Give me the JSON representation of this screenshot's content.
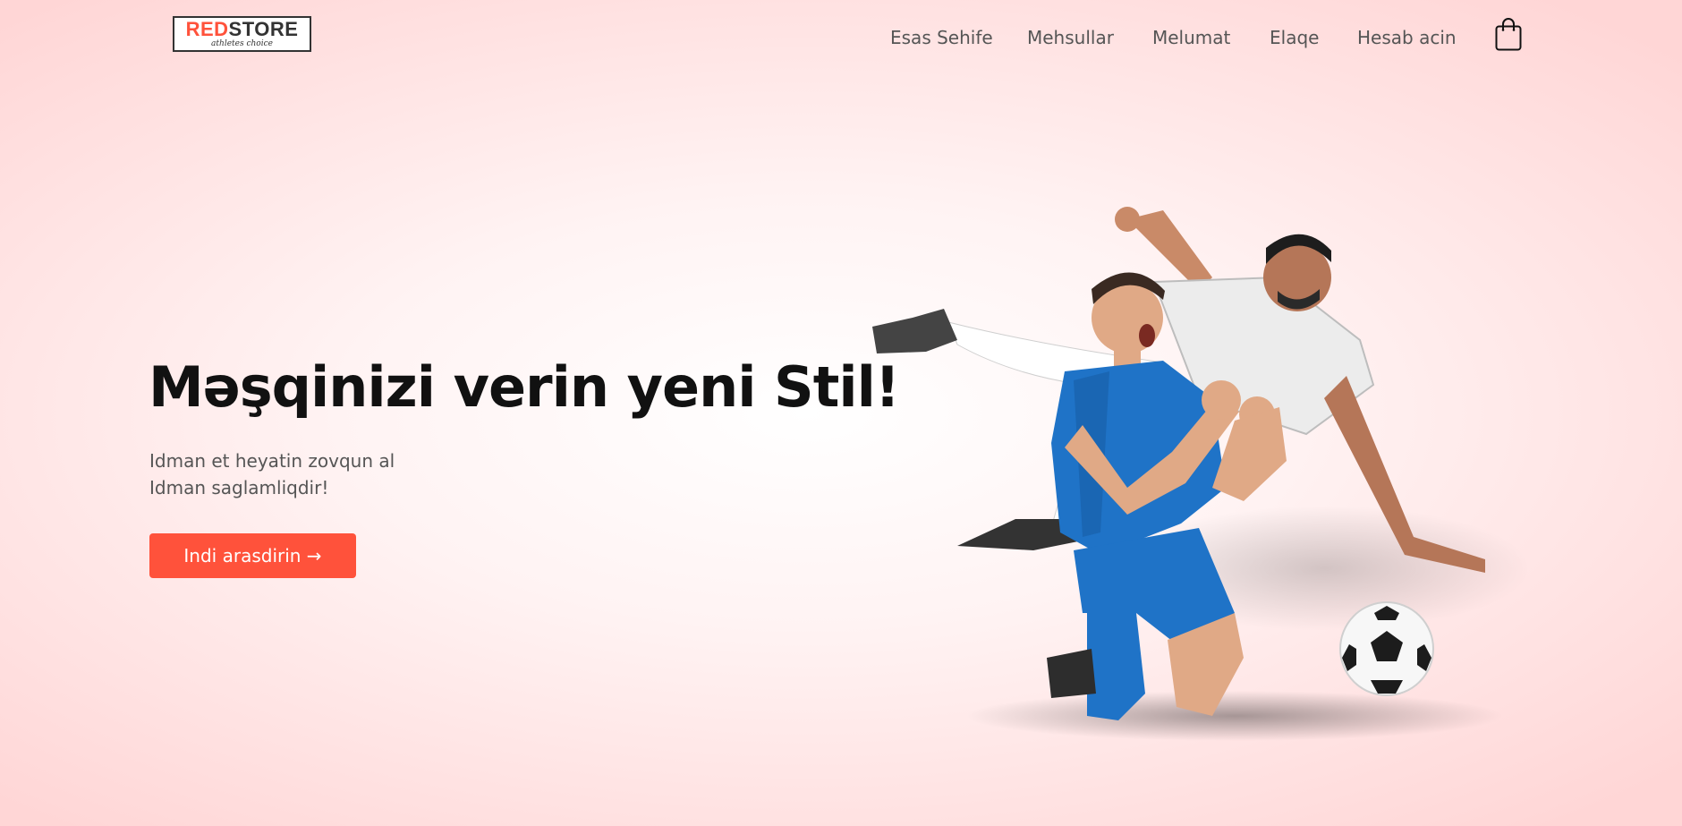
{
  "brand": {
    "logo_primary_a": "RED",
    "logo_primary_b": "STORE",
    "logo_tagline": "athletes choice",
    "accent_color": "#ff523b"
  },
  "nav": {
    "items": [
      {
        "label": "Esas Sehife"
      },
      {
        "label": "Mehsullar"
      },
      {
        "label": "Melumat"
      },
      {
        "label": "Elaqe"
      },
      {
        "label": "Hesab acin"
      }
    ],
    "cart_icon": "shopping-bag-icon"
  },
  "hero": {
    "title": "Məşqinizi verin yeni Stil!",
    "subtitle_line1": "Idman et heyatin zovqun al",
    "subtitle_line2": "Idman saglamliqdir!",
    "cta_label": "Indi arasdirin →",
    "image_subject": "two-football-players-illustration"
  }
}
